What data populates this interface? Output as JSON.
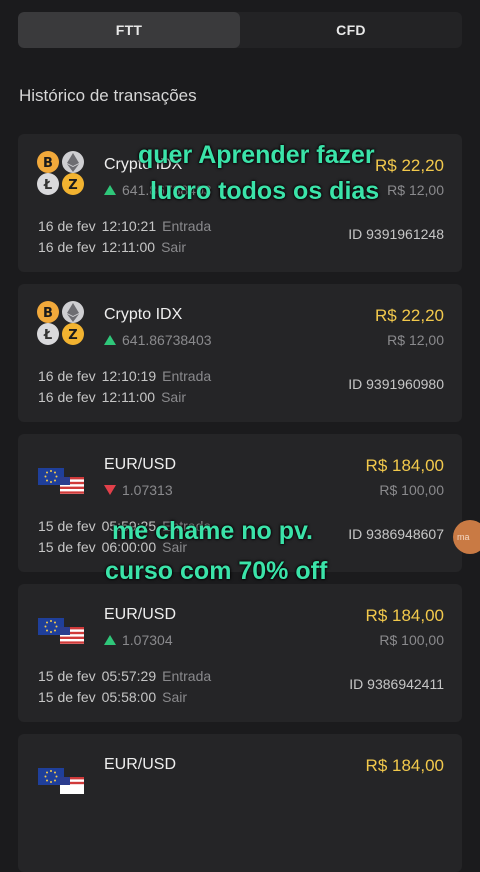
{
  "tabs": [
    {
      "label": "FTT",
      "active": true
    },
    {
      "label": "CFD",
      "active": false
    }
  ],
  "section_title": "Histórico de transações",
  "trades": [
    {
      "asset": "Crypto IDX",
      "icon": "crypto-coins-icon",
      "direction": "up",
      "quote": "641.86738403",
      "amount": "R$ 22,20",
      "invest": "R$ 12,00",
      "open_date": "16 de fev",
      "open_time": "12:10:21",
      "open_label": "Entrada",
      "close_date": "16 de fev",
      "close_time": "12:11:00",
      "close_label": "Sair",
      "id": "ID 9391961248"
    },
    {
      "asset": "Crypto IDX",
      "icon": "crypto-coins-icon",
      "direction": "up",
      "quote": "641.86738403",
      "amount": "R$ 22,20",
      "invest": "R$ 12,00",
      "open_date": "16 de fev",
      "open_time": "12:10:19",
      "open_label": "Entrada",
      "close_date": "16 de fev",
      "close_time": "12:11:00",
      "close_label": "Sair",
      "id": "ID 9391960980"
    },
    {
      "asset": "EUR/USD",
      "icon": "eur-usd-flags-icon",
      "direction": "down",
      "quote": "1.07313",
      "amount": "R$ 184,00",
      "invest": "R$ 100,00",
      "open_date": "15 de fev",
      "open_time": "05:59:25",
      "open_label": "Entrada",
      "close_date": "15 de fev",
      "close_time": "06:00:00",
      "close_label": "Sair",
      "id": "ID 9386948607"
    },
    {
      "asset": "EUR/USD",
      "icon": "eur-usd-flags-icon",
      "direction": "up",
      "quote": "1.07304",
      "amount": "R$ 184,00",
      "invest": "R$ 100,00",
      "open_date": "15 de fev",
      "open_time": "05:57:29",
      "open_label": "Entrada",
      "close_date": "15 de fev",
      "close_time": "05:58:00",
      "close_label": "Sair",
      "id": "ID 9386942411"
    },
    {
      "asset": "EUR/USD",
      "icon": "eur-usd-flags-icon",
      "direction": "up",
      "quote": "",
      "amount": "R$ 184,00",
      "invest": "",
      "open_date": "",
      "open_time": "",
      "open_label": "",
      "close_date": "",
      "close_time": "",
      "close_label": "",
      "id": ""
    }
  ],
  "overlay_texts": {
    "line1": "quer Aprender fazer",
    "line2": "lucro todos os dias",
    "line3": "me chame no pv.",
    "line4": "curso com 70% off"
  },
  "side_bubble": "ma",
  "colors": {
    "background": "#1b1b1d",
    "card": "#252527",
    "amount": "#f2c94c",
    "up": "#2fc77a",
    "down": "#e2404a",
    "overlay": "#3be3a9"
  }
}
